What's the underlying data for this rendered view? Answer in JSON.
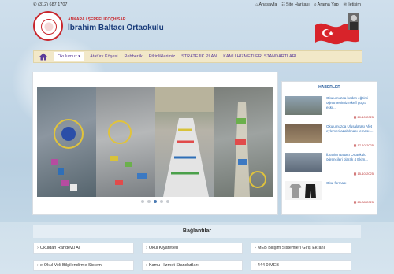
{
  "topbar": {
    "phone": "(312) 687 1707",
    "links": [
      "Anasayfa",
      "Site Haritası",
      "Arama Yap",
      "İletişim"
    ]
  },
  "header": {
    "subtitle": "ANKARA / ŞEREFLİKOÇHİSAR",
    "school_name": "İbrahim Baltacı Ortaokulu"
  },
  "nav": {
    "items": [
      "Okulumuz",
      "Atatürk Köşesi",
      "Rehberlik",
      "Etkinliklerimiz",
      "STRATEJİK PLAN",
      "KAMU HİZMETLERİ STANDARTLARI"
    ]
  },
  "news": {
    "title": "HABERLER",
    "items": [
      {
        "text": "Okulumuzda beden eğitimi öğretmenimiz Iskelî göçtü eski...",
        "date": "20-10-2025"
      },
      {
        "text": "Okulumuzda Ulusalarası Afet eylemeri azaltılması temasıı...",
        "date": "17-10-2025"
      },
      {
        "text": "İbrahim Baltacı Ortaokulu öğrencileri olarak 4 Ekim...",
        "date": "15-10-2025"
      },
      {
        "text": "Okul forması",
        "date": "25-08-2025"
      }
    ]
  },
  "links_section": {
    "title": "Bağlantılar",
    "links": [
      "Okuldan Randevu Al",
      "Okul Kıyafetleri",
      "MEB Bilişim Sistemleri Giriş Ekranı",
      "e-Okul Veli Bilgilendirme Sistemi",
      "Kamu Hizmet Standartları",
      "444 0 MEB"
    ]
  },
  "colors": {
    "nav_bg": "#f2e8c8",
    "nav_text": "#5a3b9a",
    "brand_red": "#c9262c",
    "title_blue": "#1a3c7a",
    "link_blue": "#2e6db3"
  },
  "slider": {
    "dots": 5,
    "active_dot": 2
  }
}
